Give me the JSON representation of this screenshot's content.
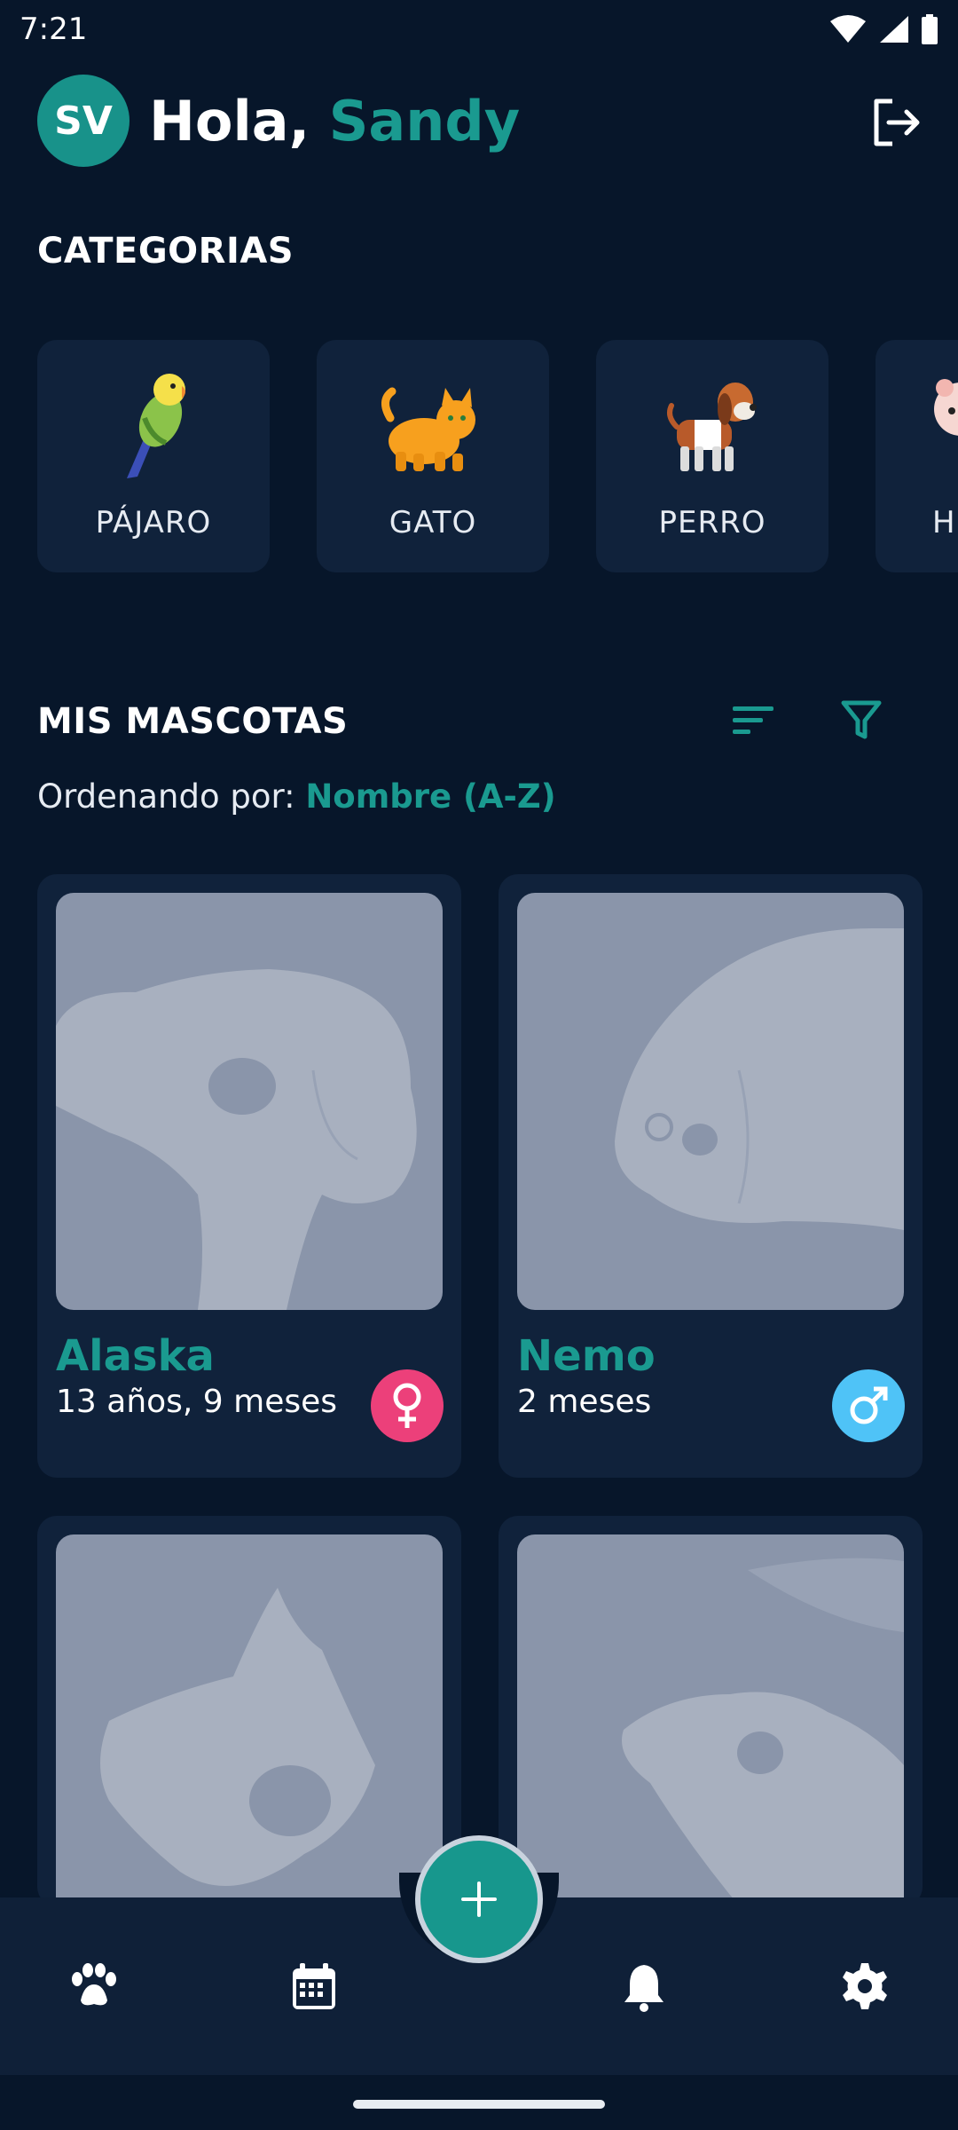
{
  "status_bar": {
    "time": "7:21"
  },
  "header": {
    "avatar_initials": "SV",
    "greeting": "Hola,",
    "user_name": "Sandy"
  },
  "categories": {
    "title": "CATEGORIAS",
    "items": [
      {
        "label": "PÁJARO",
        "icon": "parakeet-icon"
      },
      {
        "label": "GATO",
        "icon": "cat-icon"
      },
      {
        "label": "PERRO",
        "icon": "dog-icon"
      },
      {
        "label": "H",
        "icon": "hamster-icon"
      }
    ]
  },
  "my_pets": {
    "title": "MIS MASCOTAS",
    "sort_prefix": "Ordenando por:",
    "sort_value": "Nombre (A-Z)",
    "pets": [
      {
        "name": "Alaska",
        "age": "13 años, 9 meses",
        "gender": "female",
        "gender_color": "#ec407a"
      },
      {
        "name": "Nemo",
        "age": "2 meses",
        "gender": "male",
        "gender_color": "#4fc3f7"
      },
      {
        "name": "",
        "age": "",
        "gender": "",
        "gender_color": ""
      },
      {
        "name": "",
        "age": "",
        "gender": "",
        "gender_color": ""
      }
    ]
  },
  "colors": {
    "background": "#07162a",
    "card": "#10223b",
    "accent": "#1a9a90"
  }
}
